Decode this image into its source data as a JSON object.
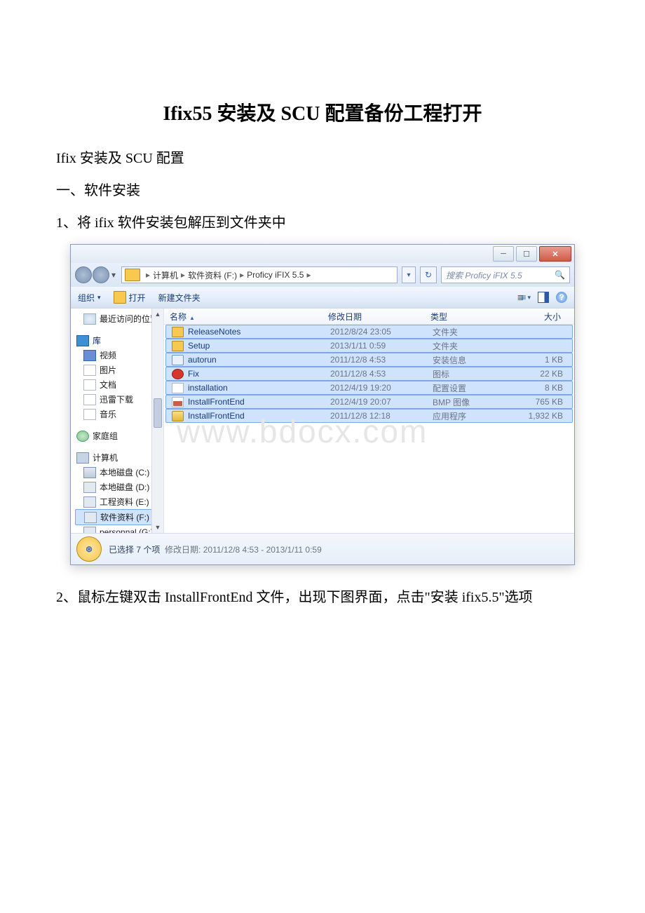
{
  "doc": {
    "title": "Ifix55 安装及 SCU 配置备份工程打开",
    "subtitle": "Ifix 安装及 SCU 配置",
    "section1": "一、软件安装",
    "step1": "1、将 ifix 软件安装包解压到文件夹中",
    "step2": "2、鼠标左键双击 InstallFrontEnd 文件，出现下图界面，点击\"安装 ifix5.5\"选项"
  },
  "watermark": "www.bdocx.com",
  "explorer": {
    "breadcrumb": [
      "计算机",
      "软件资料 (F:)",
      "Proficy iFIX 5.5"
    ],
    "search_placeholder": "搜索 Proficy iFIX 5.5",
    "toolbar": {
      "organize": "组织",
      "open": "打开",
      "newfolder": "新建文件夹"
    },
    "columns": {
      "name": "名称",
      "date": "修改日期",
      "type": "类型",
      "size": "大小"
    },
    "sidebar": {
      "recent": "最近访问的位置",
      "library": "库",
      "video": "视频",
      "images": "图片",
      "docs": "文档",
      "xunlei": "迅雷下载",
      "music": "音乐",
      "homegroup": "家庭组",
      "computer": "计算机",
      "drives": [
        "本地磁盘 (C:)",
        "本地磁盘 (D:)",
        "工程资料 (E:)",
        "软件资料 (F:)",
        "personnal (G:)"
      ]
    },
    "files": [
      {
        "icon": "folder",
        "name": "ReleaseNotes",
        "date": "2012/8/24 23:05",
        "type": "文件夹",
        "size": ""
      },
      {
        "icon": "folder",
        "name": "Setup",
        "date": "2013/1/11 0:59",
        "type": "文件夹",
        "size": ""
      },
      {
        "icon": "gear",
        "name": "autorun",
        "date": "2011/12/8 4:53",
        "type": "安装信息",
        "size": "1 KB"
      },
      {
        "icon": "fix",
        "name": "Fix",
        "date": "2011/12/8 4:53",
        "type": "图标",
        "size": "22 KB"
      },
      {
        "icon": "ini",
        "name": "installation",
        "date": "2012/4/19 19:20",
        "type": "配置设置",
        "size": "8 KB"
      },
      {
        "icon": "bmp",
        "name": "InstallFrontEnd",
        "date": "2012/4/19 20:07",
        "type": "BMP 图像",
        "size": "765 KB"
      },
      {
        "icon": "exe",
        "name": "InstallFrontEnd",
        "date": "2011/12/8 12:18",
        "type": "应用程序",
        "size": "1,932 KB"
      }
    ],
    "status": {
      "main_pre": "已选择 7 个项",
      "detail_label": "修改日期:",
      "detail_value": "2011/12/8 4:53 - 2013/1/11 0:59"
    }
  }
}
